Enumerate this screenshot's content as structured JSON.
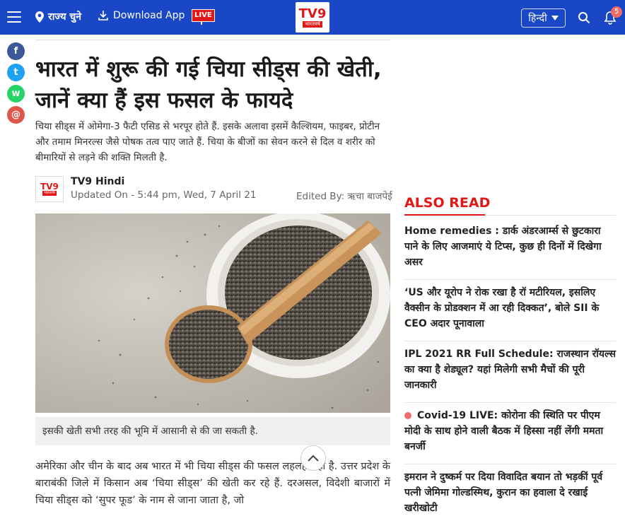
{
  "header": {
    "state_label": "राज्य चुने",
    "download_label": "Download App",
    "live_label": "LIVE",
    "logo_text": "TV9",
    "logo_sub": "भारतवर्ष",
    "language": "हिन्दी",
    "notification_count": "5",
    "colors": {
      "bar": "#1a47c5",
      "live": "#e01818"
    }
  },
  "share": {
    "icons": [
      "facebook-icon",
      "twitter-icon",
      "whatsapp-icon",
      "email-icon"
    ],
    "glyphs": [
      "f",
      "t",
      "w",
      "@"
    ],
    "colors": [
      "#3b5998",
      "#1da1f2",
      "#25d366",
      "#e0574a"
    ]
  },
  "article": {
    "title": "भारत में शुरू की गई चिया सीड्स की खेती, जानें क्या हैं इस फसल के फायदे",
    "summary": "चिया सीड्स में ओमेगा-3 फैटी एसिड से भरपूर होते हैं. इसके अलावा इसमें कैल्शियम, फाइबर, प्रोटीन और तमाम मिनरल्स जैसे पोषक तत्व पाए जाते हैं. चिया के बीजों का सेवन करने से दिल व शरीर को बीमारियों से लड़ने की शक्ति मिलती है.",
    "author": "TV9 Hindi",
    "updated": "Updated On - 5:44 pm, Wed, 7 April 21",
    "edited_by": "Edited By: ऋचा बाजपेई",
    "caption": "इसकी खेती सभी तरह की भूमि में आसानी से की जा सकती है.",
    "body": "अमेरिका और चीन के बाद अब भारत में भी चिया सीड्स की फसल लहलहा रही है. उत्तर प्रदेश के बाराबंकी जिले में किसान अब ‘चिया सीड्स’ की खेती कर रहे हैं. दरअसल, विदेशी बाजारों में चिया सीड्स को ‘सुपर फूड’ के नाम से जाना जाता है, जो"
  },
  "also_read": {
    "heading": "ALSO READ",
    "items": [
      "Home remedies : डार्क अंडरआर्म्स से छुटकारा पाने के लिए आजमाएं ये टिप्स, कुछ ही दिनों में दिखेगा असर",
      "‘US और यूरोप ने रोक रखा है रॉ मटीरियल, इसलिए वैक्सीन के प्रोडक्शन में आ रही दिक्कत’, बोले SII के CEO अदार पूनावाला",
      "IPL 2021 RR Full Schedule: राजस्थान रॉयल्स का क्या है शेड्यूल? यहां मिलेगी सभी मैचों की पूरी जानकारी",
      "Covid-19 LIVE: कोरोना की स्थिति पर पीएम मोदी के साथ होने वाली बैठक में हिस्सा नहीं लेंगी ममता बनर्जी",
      "इमरान ने दुष्कर्म पर दिया विवादित बयान तो भड़कीं पूर्व पत्नी जेमिमा गोल्डस्मिथ, कुरान का हवाला दे रखाई खरीखोटी"
    ]
  }
}
